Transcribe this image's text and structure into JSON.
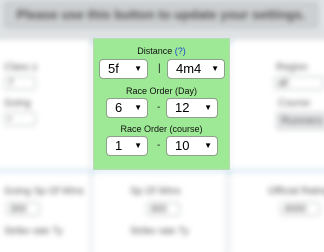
{
  "update_banner": {
    "text": "Please use this button to update your settings."
  },
  "filter_panel": {
    "distance": {
      "label": "Distance",
      "help": "(?)",
      "min_value": "5f",
      "separator": "|",
      "max_value": "4m4"
    },
    "race_order_day": {
      "label": "Race Order (Day)",
      "min_value": "6",
      "separator": "-",
      "max_value": "12"
    },
    "race_order_course": {
      "label": "Race Order (course)",
      "min_value": "1",
      "separator": "-",
      "max_value": "10"
    }
  },
  "background": {
    "left_top": {
      "label_a": "Class ≥",
      "select_a": "7",
      "label_b": "Going",
      "select_b": "•"
    },
    "right_top": {
      "label_a": "Region",
      "select_a": "all",
      "label_b": "Course",
      "select_b": "Runners"
    },
    "bottom": {
      "left_label": "Going Sp Of Wins",
      "left_select": "300",
      "left_label_b": "Strike rate Ty",
      "mid_label": "Sp Of Wins",
      "mid_select": "300",
      "mid_label_b": "Strike rate Ty",
      "right_label": "Official Rating",
      "right_select": "4000"
    }
  }
}
